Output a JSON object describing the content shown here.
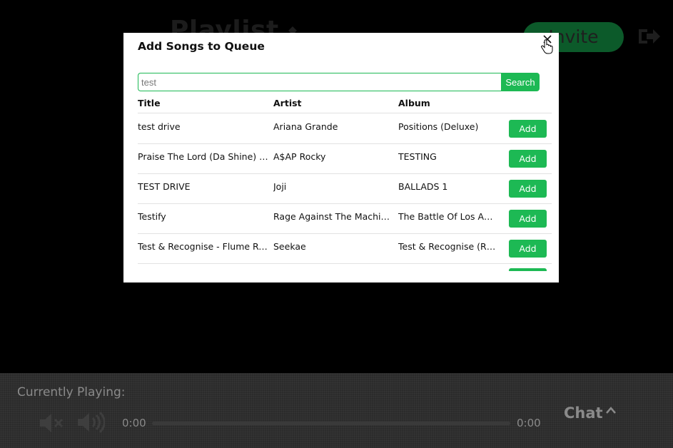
{
  "background": {
    "title": "Playlist",
    "invite_label": "Invite",
    "title_icon": "diamond-icon",
    "logout_icon": "logout-icon"
  },
  "player": {
    "currently_playing_label": "Currently Playing:",
    "time_elapsed": "0:00",
    "time_total": "0:00",
    "progress": 0,
    "chat_label": "Chat",
    "mute_icon": "mute-icon",
    "volume_icon": "volume-icon",
    "chat_caret_icon": "chevron-up-icon"
  },
  "modal": {
    "title": "Add Songs to Queue",
    "close_icon": "close-icon",
    "search": {
      "value": "test",
      "placeholder": "",
      "button_label": "Search"
    },
    "columns": {
      "title": "Title",
      "artist": "Artist",
      "album": "Album"
    },
    "rows": [
      {
        "title": "test drive",
        "artist": "Ariana Grande",
        "album": "Positions (Deluxe)",
        "action": "Add"
      },
      {
        "title": "Praise The Lord (Da Shine) (fe…",
        "artist": "A$AP Rocky",
        "album": "TESTING",
        "action": "Add"
      },
      {
        "title": "TEST DRIVE",
        "artist": "Joji",
        "album": "BALLADS 1",
        "action": "Add"
      },
      {
        "title": "Testify",
        "artist": "Rage Against The Machi…",
        "album": "The Battle Of Los An…",
        "action": "Add"
      },
      {
        "title": "Test & Recognise - Flume Re-…",
        "artist": "Seekae",
        "album": "Test & Recognise (R…",
        "action": "Add"
      }
    ]
  },
  "colors": {
    "accent": "#1db954",
    "background": "#000000",
    "modal": "#ffffff",
    "player": "#2b2b2b"
  }
}
